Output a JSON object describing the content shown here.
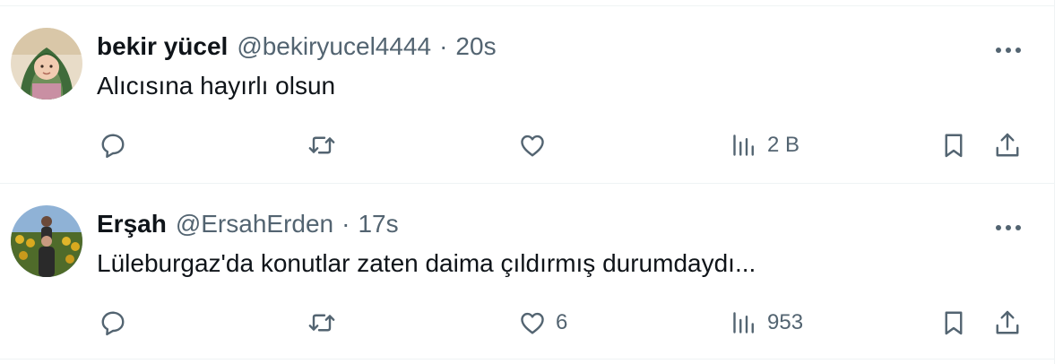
{
  "tweets": [
    {
      "display_name": "bekir yücel",
      "handle": "@bekiryucel4444",
      "separator": "·",
      "time": "20s",
      "text": "Alıcısına hayırlı olsun",
      "replies": "",
      "retweets": "",
      "likes": "",
      "views": "2 B",
      "avatar": "child-in-headscarf-photo"
    },
    {
      "display_name": "Erşah",
      "handle": "@ErsahErden",
      "separator": "·",
      "time": "17s",
      "text": "Lüleburgaz'da konutlar zaten daima çıldırmış durumdaydı...",
      "replies": "",
      "retweets": "",
      "likes": "6",
      "views": "953",
      "avatar": "person-in-sunflower-field-photo"
    }
  ],
  "icons": {
    "reply": "speech-bubble-icon",
    "retweet": "retweet-arrows-icon",
    "like": "heart-icon",
    "views": "bar-chart-icon",
    "bookmark": "bookmark-icon",
    "share": "share-upload-icon",
    "more": "ellipsis-icon"
  },
  "colors": {
    "primary_text": "#0f1419",
    "secondary_text": "#536471",
    "divider": "#eff3f4"
  }
}
